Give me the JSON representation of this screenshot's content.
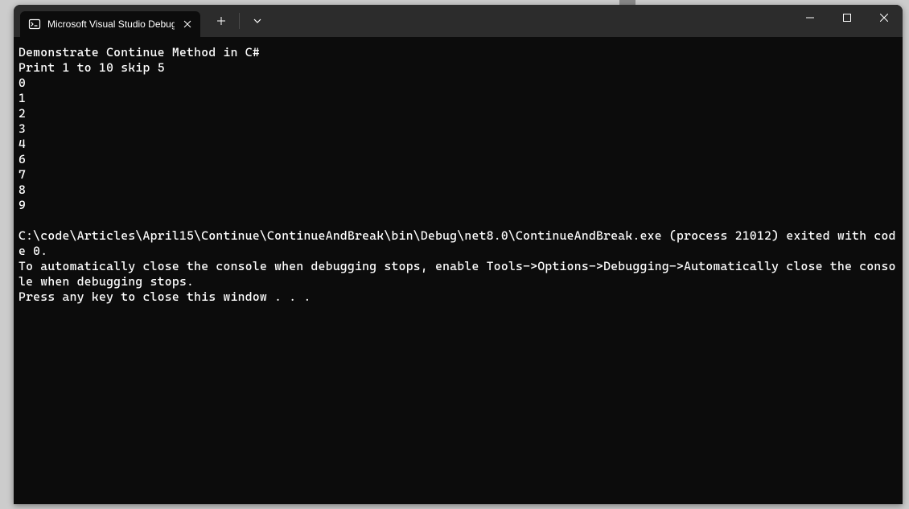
{
  "tab": {
    "title": "Microsoft Visual Studio Debug"
  },
  "console": {
    "lines": [
      "Demonstrate Continue Method in C#",
      "Print 1 to 10 skip 5",
      "0",
      "1",
      "2",
      "3",
      "4",
      "6",
      "7",
      "8",
      "9",
      "",
      "C:\\code\\Articles\\April15\\Continue\\ContinueAndBreak\\bin\\Debug\\net8.0\\ContinueAndBreak.exe (process 21012) exited with code 0.",
      "To automatically close the console when debugging stops, enable Tools->Options->Debugging->Automatically close the console when debugging stops.",
      "Press any key to close this window . . ."
    ]
  }
}
